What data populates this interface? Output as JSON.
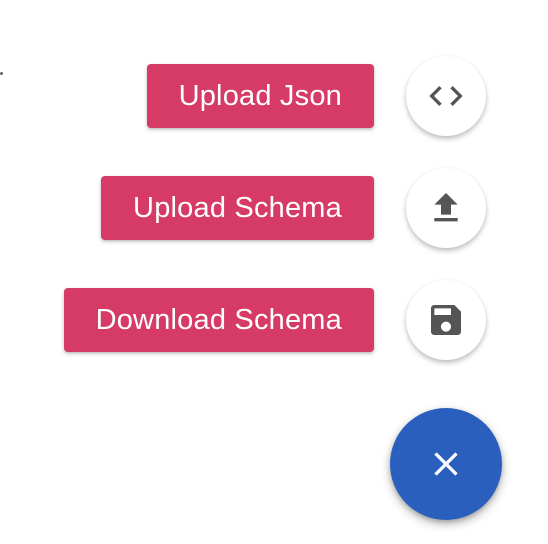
{
  "speed_dial": {
    "actions": [
      {
        "label": "Upload Json",
        "icon": "code-icon"
      },
      {
        "label": "Upload Schema",
        "icon": "upload-icon"
      },
      {
        "label": "Download Schema",
        "icon": "save-icon"
      }
    ],
    "main_button": {
      "icon": "close-icon"
    }
  },
  "colors": {
    "label_background": "#d63a66",
    "label_text": "#ffffff",
    "mini_fab_background": "#ffffff",
    "mini_fab_icon": "#555555",
    "main_fab_background": "#2b5fbd",
    "main_fab_icon": "#ffffff"
  }
}
